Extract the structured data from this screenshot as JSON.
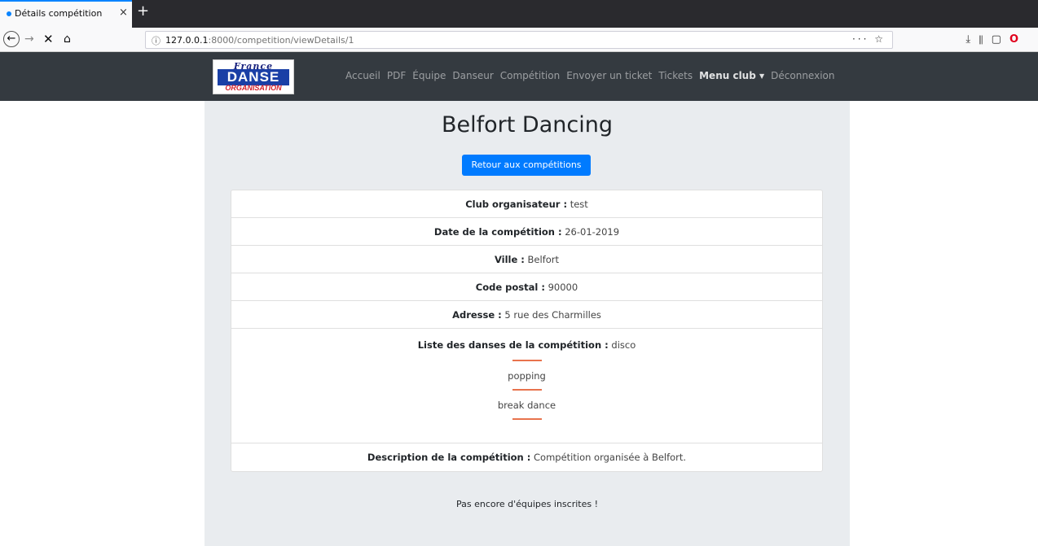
{
  "browser": {
    "tab_title": "Détails compétition",
    "tab_close": "×",
    "new_tab": "+",
    "url_host": "127.0.0.1",
    "url_rest": ":8000/competition/viewDetails/1",
    "url_actions": "··· ☆",
    "back": "←",
    "forward": "→",
    "stop": "✕",
    "home": "⌂"
  },
  "logo": {
    "top": "France",
    "mid": "DANSE",
    "bot": "ORGANISATION"
  },
  "menu": {
    "items": [
      "Accueil",
      "PDF",
      "Équipe",
      "Danseur",
      "Compétition",
      "Envoyer un ticket",
      "Tickets"
    ],
    "club": "Menu club",
    "logout": "Déconnexion"
  },
  "page": {
    "title": "Belfort Dancing",
    "back_button": "Retour aux compétitions",
    "details": {
      "club_label": "Club organisateur :",
      "club_value": "test",
      "date_label": "Date de la compétition :",
      "date_value": "26-01-2019",
      "city_label": "Ville :",
      "city_value": "Belfort",
      "postal_label": "Code postal :",
      "postal_value": "90000",
      "address_label": "Adresse :",
      "address_value": "5 rue des Charmilles",
      "dances_label": "Liste des danses de la compétition :",
      "dances": [
        "disco",
        "popping",
        "break dance"
      ],
      "desc_label": "Description de la compétition :",
      "desc_value": "Compétition organisée à Belfort."
    },
    "no_teams": "Pas encore d'équipes inscrites !"
  },
  "colors": {
    "navbar": "#343a40",
    "content_bg": "#e9ecef",
    "primary": "#007bff",
    "separator": "#e8734d"
  }
}
